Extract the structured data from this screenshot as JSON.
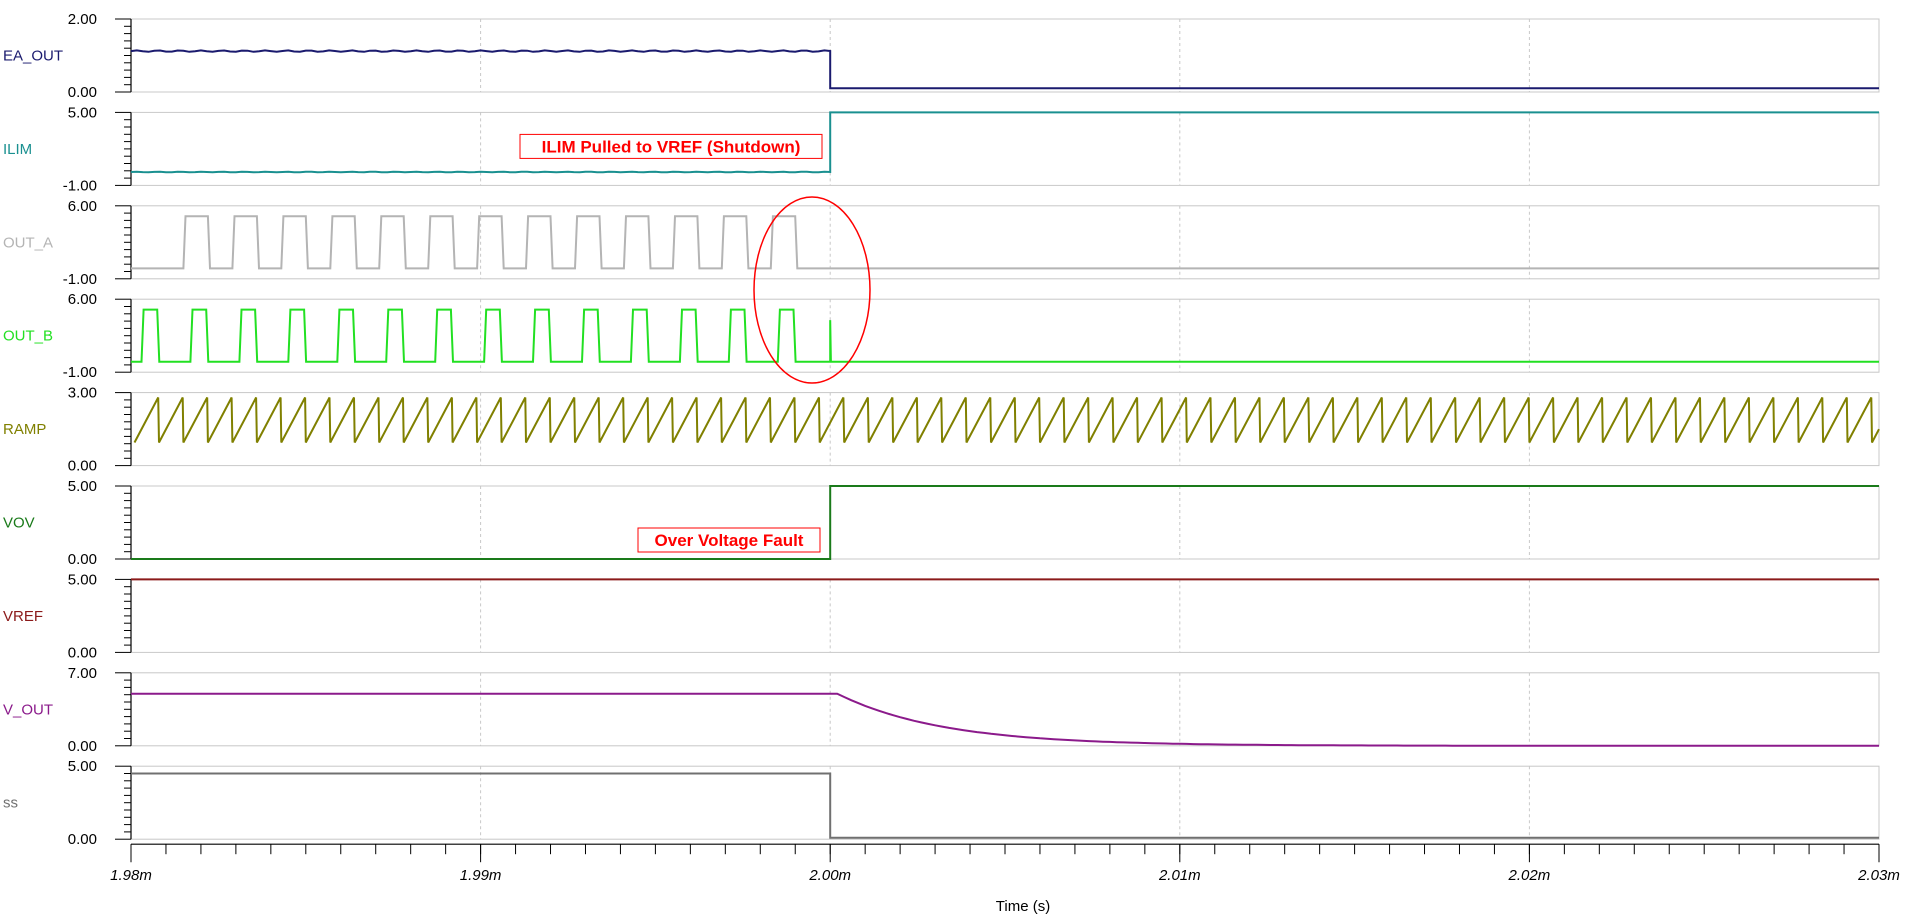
{
  "chart_data": {
    "type": "line",
    "xlabel": "Time (s)",
    "x_unit_note": "milliseconds",
    "xlim": [
      1.98,
      2.03
    ],
    "x_ticks": [
      {
        "value": 1.98,
        "label": "1.98m"
      },
      {
        "value": 1.99,
        "label": "1.99m"
      },
      {
        "value": 2.0,
        "label": "2.00m"
      },
      {
        "value": 2.01,
        "label": "2.01m"
      },
      {
        "value": 2.02,
        "label": "2.02m"
      },
      {
        "value": 2.03,
        "label": "2.03m"
      }
    ],
    "grid": "vertical-dashed",
    "series": [
      {
        "name": "EA_OUT",
        "color": "#1a1a6e",
        "ylim": [
          0,
          2
        ],
        "ytick_labels": [
          "0.00",
          "2.00"
        ],
        "shape": "ripple-step",
        "before": {
          "value": 1.12,
          "ripple": 0.04
        },
        "after": {
          "value": 0.1
        }
      },
      {
        "name": "ILIM",
        "color": "#1a9090",
        "ylim": [
          -1,
          5
        ],
        "ytick_labels": [
          "-1.00",
          "5.00"
        ],
        "shape": "ripple-step",
        "before": {
          "value": 0.1,
          "ripple": 0.05
        },
        "after": {
          "value": 5.0
        }
      },
      {
        "name": "OUT_A",
        "color": "#b4b4b4",
        "ylim": [
          -1,
          6
        ],
        "ytick_labels": [
          "-1.00",
          "6.00"
        ],
        "shape": "pulse-train",
        "low": 0.0,
        "high": 5.0,
        "first_rise": 1.9815,
        "period": 0.0014,
        "width": 0.0007,
        "stop": 2.0
      },
      {
        "name": "OUT_B",
        "color": "#22e022",
        "ylim": [
          -1,
          6
        ],
        "ytick_labels": [
          "-1.00",
          "6.00"
        ],
        "shape": "pulse-train",
        "low": 0.0,
        "high": 5.0,
        "first_rise": 1.9803,
        "period": 0.0014,
        "width": 0.00045,
        "stop": 2.0,
        "final_spike": 2.0
      },
      {
        "name": "RAMP",
        "color": "#808000",
        "ylim": [
          0,
          3
        ],
        "ytick_labels": [
          "0.00",
          "3.00"
        ],
        "shape": "sawtooth",
        "low": 0.95,
        "high": 2.8,
        "period": 0.0007,
        "start": 1.9801
      },
      {
        "name": "VOV",
        "color": "#1a7a1a",
        "ylim": [
          0,
          5
        ],
        "ytick_labels": [
          "0.00",
          "5.00"
        ],
        "shape": "step",
        "before": {
          "value": 0.0
        },
        "after": {
          "value": 5.0
        }
      },
      {
        "name": "VREF",
        "color": "#8b1a1a",
        "ylim": [
          0,
          5
        ],
        "ytick_labels": [
          "0.00",
          "5.00"
        ],
        "shape": "constant",
        "value": 5.0
      },
      {
        "name": "V_OUT",
        "color": "#8b1a8b",
        "ylim": [
          0,
          7
        ],
        "ytick_labels": [
          "0.00",
          "7.00"
        ],
        "shape": "decay",
        "before": {
          "value": 5.0
        },
        "after": {
          "value": 0.0,
          "delay": 0.0002,
          "tau": 0.003
        }
      },
      {
        "name": "ss",
        "color": "#707070",
        "ylim": [
          0,
          5
        ],
        "ytick_labels": [
          "0.00",
          "5.00"
        ],
        "shape": "step",
        "before": {
          "value": 4.5
        },
        "after": {
          "value": 0.1
        }
      }
    ],
    "event_time": 2.0,
    "annotations": [
      {
        "text": "ILIM Pulled to VREF (Shutdown)",
        "panel": "ILIM",
        "color": "#ff0000"
      },
      {
        "text": "Over Voltage Fault",
        "panel": "VOV",
        "color": "#ff0000"
      }
    ]
  }
}
